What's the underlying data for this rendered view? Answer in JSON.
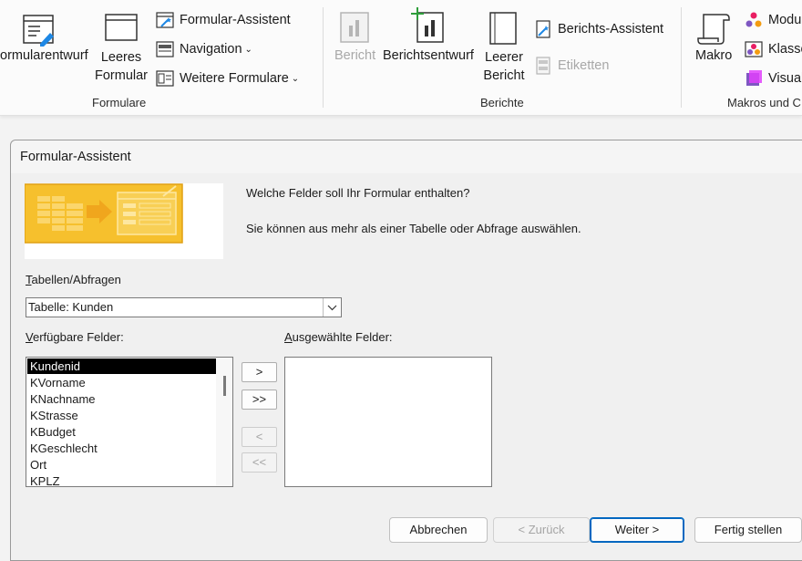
{
  "ribbon": {
    "formulare": {
      "formularentwurf": "ormularentwurf",
      "leeres_formular": [
        "Leeres",
        "Formular"
      ],
      "formular_assistent": "Formular-Assistent",
      "navigation": "Navigation",
      "weitere_formulare": "Weitere Formulare",
      "group_label": "Formulare"
    },
    "berichte": {
      "bericht": "Bericht",
      "berichtsentwurf": "Berichtsentwurf",
      "leerer_bericht": [
        "Leerer",
        "Bericht"
      ],
      "berichts_assistent": "Berichts-Assistent",
      "etiketten": "Etiketten",
      "group_label": "Berichte"
    },
    "makros": {
      "makro": "Makro",
      "modul": "Modu",
      "klasse": "Klasse",
      "visual": "Visual",
      "group_label": "Makros und C"
    }
  },
  "dialog": {
    "title": "Formular-Assistent",
    "question": "Welche Felder soll Ihr Formular enthalten?",
    "hint": "Sie können aus mehr als einer Tabelle oder Abfrage auswählen.",
    "tables_label": {
      "underlined": "T",
      "rest": "abellen/Abfragen"
    },
    "table_value": "Tabelle: Kunden",
    "available_label": {
      "underlined": "V",
      "rest": "erfügbare Felder:"
    },
    "selected_label": {
      "underlined": "A",
      "rest": "usgewählte Felder:"
    },
    "available_fields": [
      "Kundenid",
      "KVorname",
      "KNachname",
      "KStrasse",
      "KBudget",
      "KGeschlecht",
      "Ort",
      "KPLZ"
    ],
    "selected_index": 0,
    "move_buttons": [
      ">",
      ">>",
      "<",
      "<<"
    ],
    "cancel": "Abbrechen",
    "back": "< Zurück",
    "next": "Weiter >",
    "finish": "Fertig stellen"
  },
  "colors": {
    "accent": "#0067c0",
    "banner": "#f7c12e",
    "banner_dark": "#e6a21b",
    "selection": "#000000"
  }
}
